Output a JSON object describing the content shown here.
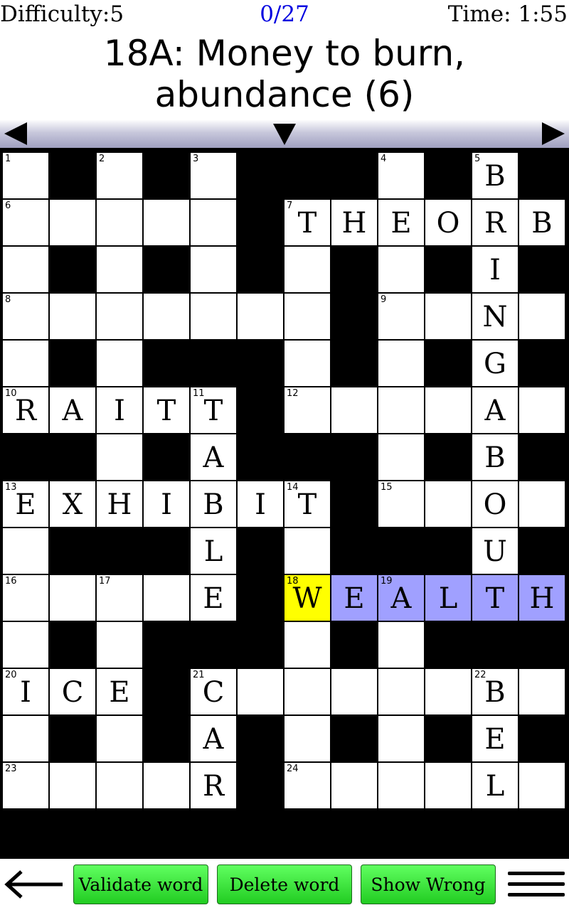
{
  "status": {
    "difficulty": "Difficulty:5",
    "progress": "0/27",
    "time": "Time: 1:55"
  },
  "clue": {
    "line1": "18A: Money to burn,",
    "line2": "abundance (6)"
  },
  "grid": {
    "rows": [
      "#.#.#.###.#.#",
      ".....#.......",
      ".#.#.#.#.#.#",
      ".......#.....",
      ".#.###.#.#.#",
      ".....#.......",
      "##.#.#.###.#",
      ".......#.....",
      ".###.#.######",
      ".....#.......",
      ".#.###.#.####",
      "...#.........",
      ".#.#.#.#.#.#",
      ".....#.......",
      "#############"
    ],
    "cells": [
      {
        "r": 0,
        "c": 0,
        "n": "1"
      },
      {
        "r": 0,
        "c": 2,
        "n": "2"
      },
      {
        "r": 0,
        "c": 4,
        "n": "3"
      },
      {
        "r": 0,
        "c": 8,
        "n": "4"
      },
      {
        "r": 0,
        "c": 10,
        "n": "5",
        "l": "B"
      },
      {
        "r": 1,
        "c": 0,
        "n": "6"
      },
      {
        "r": 1,
        "c": 1
      },
      {
        "r": 1,
        "c": 2
      },
      {
        "r": 1,
        "c": 3
      },
      {
        "r": 1,
        "c": 4
      },
      {
        "r": 1,
        "c": 6,
        "n": "7",
        "l": "T"
      },
      {
        "r": 1,
        "c": 7,
        "l": "H"
      },
      {
        "r": 1,
        "c": 8,
        "l": "E"
      },
      {
        "r": 1,
        "c": 9,
        "l": "O"
      },
      {
        "r": 1,
        "c": 10,
        "l": "R"
      },
      {
        "r": 1,
        "c": 11,
        "l": "B"
      },
      {
        "r": 2,
        "c": 0
      },
      {
        "r": 2,
        "c": 2
      },
      {
        "r": 2,
        "c": 4
      },
      {
        "r": 2,
        "c": 6
      },
      {
        "r": 2,
        "c": 8
      },
      {
        "r": 2,
        "c": 10,
        "l": "I"
      },
      {
        "r": 3,
        "c": 0,
        "n": "8"
      },
      {
        "r": 3,
        "c": 1
      },
      {
        "r": 3,
        "c": 2
      },
      {
        "r": 3,
        "c": 3
      },
      {
        "r": 3,
        "c": 4
      },
      {
        "r": 3,
        "c": 5
      },
      {
        "r": 3,
        "c": 6
      },
      {
        "r": 3,
        "c": 8,
        "n": "9"
      },
      {
        "r": 3,
        "c": 9
      },
      {
        "r": 3,
        "c": 10,
        "l": "N"
      },
      {
        "r": 3,
        "c": 11
      },
      {
        "r": 4,
        "c": 0
      },
      {
        "r": 4,
        "c": 2
      },
      {
        "r": 4,
        "c": 6
      },
      {
        "r": 4,
        "c": 8
      },
      {
        "r": 4,
        "c": 10,
        "l": "G"
      },
      {
        "r": 5,
        "c": 0,
        "n": "10",
        "l": "R"
      },
      {
        "r": 5,
        "c": 1,
        "l": "A"
      },
      {
        "r": 5,
        "c": 2,
        "l": "I"
      },
      {
        "r": 5,
        "c": 3,
        "l": "T"
      },
      {
        "r": 5,
        "c": 4,
        "n": "11",
        "l": "T"
      },
      {
        "r": 5,
        "c": 6,
        "n": "12"
      },
      {
        "r": 5,
        "c": 7
      },
      {
        "r": 5,
        "c": 8
      },
      {
        "r": 5,
        "c": 9
      },
      {
        "r": 5,
        "c": 10,
        "l": "A"
      },
      {
        "r": 5,
        "c": 11
      },
      {
        "r": 6,
        "c": 2
      },
      {
        "r": 6,
        "c": 4,
        "l": "A"
      },
      {
        "r": 6,
        "c": 8
      },
      {
        "r": 6,
        "c": 10,
        "l": "B"
      },
      {
        "r": 7,
        "c": 0,
        "n": "13",
        "l": "E"
      },
      {
        "r": 7,
        "c": 1,
        "l": "X"
      },
      {
        "r": 7,
        "c": 2,
        "l": "H"
      },
      {
        "r": 7,
        "c": 3,
        "l": "I"
      },
      {
        "r": 7,
        "c": 4,
        "l": "B"
      },
      {
        "r": 7,
        "c": 5,
        "l": "I"
      },
      {
        "r": 7,
        "c": 6,
        "n": "14",
        "l": "T"
      },
      {
        "r": 7,
        "c": 8,
        "n": "15"
      },
      {
        "r": 7,
        "c": 9
      },
      {
        "r": 7,
        "c": 10,
        "l": "O"
      },
      {
        "r": 7,
        "c": 11
      },
      {
        "r": 8,
        "c": 0
      },
      {
        "r": 8,
        "c": 4,
        "l": "L"
      },
      {
        "r": 8,
        "c": 6
      },
      {
        "r": 8,
        "c": 10,
        "l": "U"
      },
      {
        "r": 9,
        "c": 0,
        "n": "16"
      },
      {
        "r": 9,
        "c": 1
      },
      {
        "r": 9,
        "c": 2,
        "n": "17"
      },
      {
        "r": 9,
        "c": 3
      },
      {
        "r": 9,
        "c": 4,
        "l": "E"
      },
      {
        "r": 9,
        "c": 6,
        "n": "18",
        "l": "W",
        "s": "sel"
      },
      {
        "r": 9,
        "c": 7,
        "l": "E",
        "s": "word"
      },
      {
        "r": 9,
        "c": 8,
        "n": "19",
        "l": "A",
        "s": "word"
      },
      {
        "r": 9,
        "c": 9,
        "l": "L",
        "s": "word"
      },
      {
        "r": 9,
        "c": 10,
        "l": "T",
        "s": "word"
      },
      {
        "r": 9,
        "c": 11,
        "l": "H",
        "s": "word"
      },
      {
        "r": 10,
        "c": 0
      },
      {
        "r": 10,
        "c": 2
      },
      {
        "r": 10,
        "c": 6
      },
      {
        "r": 10,
        "c": 8
      },
      {
        "r": 11,
        "c": 0,
        "n": "20",
        "l": "I"
      },
      {
        "r": 11,
        "c": 1,
        "l": "C"
      },
      {
        "r": 11,
        "c": 2,
        "l": "E"
      },
      {
        "r": 11,
        "c": 4,
        "n": "21",
        "l": "C"
      },
      {
        "r": 11,
        "c": 5
      },
      {
        "r": 11,
        "c": 6
      },
      {
        "r": 11,
        "c": 7
      },
      {
        "r": 11,
        "c": 8
      },
      {
        "r": 11,
        "c": 9
      },
      {
        "r": 11,
        "c": 10,
        "n": "22",
        "l": "B"
      },
      {
        "r": 11,
        "c": 11
      },
      {
        "r": 12,
        "c": 0
      },
      {
        "r": 12,
        "c": 2
      },
      {
        "r": 12,
        "c": 4,
        "l": "A"
      },
      {
        "r": 12,
        "c": 6
      },
      {
        "r": 12,
        "c": 8
      },
      {
        "r": 12,
        "c": 10,
        "l": "E"
      },
      {
        "r": 13,
        "c": 0,
        "n": "23"
      },
      {
        "r": 13,
        "c": 1
      },
      {
        "r": 13,
        "c": 2
      },
      {
        "r": 13,
        "c": 3
      },
      {
        "r": 13,
        "c": 4,
        "l": "R"
      },
      {
        "r": 13,
        "c": 6,
        "n": "24"
      },
      {
        "r": 13,
        "c": 7
      },
      {
        "r": 13,
        "c": 8
      },
      {
        "r": 13,
        "c": 9
      },
      {
        "r": 13,
        "c": 10,
        "l": "L"
      },
      {
        "r": 13,
        "c": 11
      }
    ]
  },
  "toolbar": {
    "validate_label": "Validate word",
    "delete_label": "Delete word",
    "wrong_label": "Show Wrong"
  },
  "icons": {
    "back": "left-arrow-icon",
    "menu": "hamburger-menu-icon"
  },
  "colors": {
    "selected": "#ffff00",
    "word": "#a0a0ff",
    "button": "#33dd33",
    "progress": "#0000e0"
  }
}
